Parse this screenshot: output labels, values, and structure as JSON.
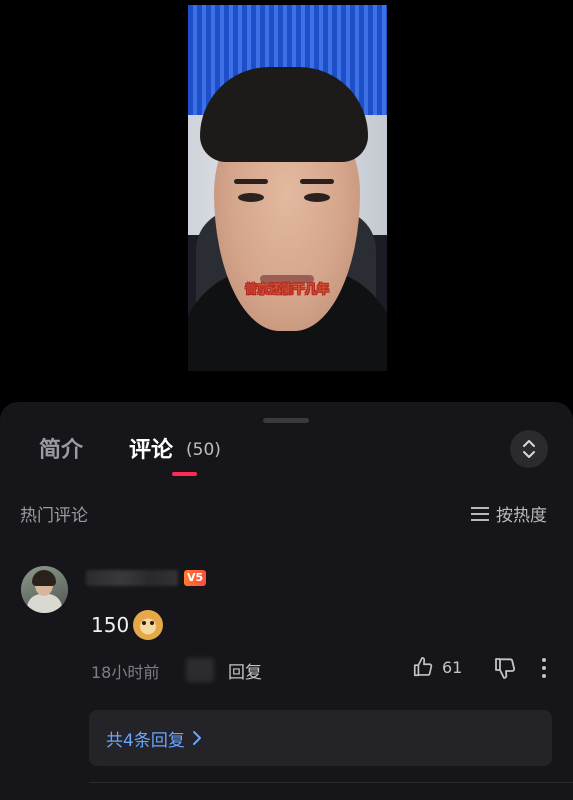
{
  "video": {
    "subtitle": "普京还能干几年"
  },
  "sheet": {
    "tabs": [
      {
        "label": "简介"
      },
      {
        "label": "评论"
      }
    ],
    "comment_count": "(50)",
    "section_title": "热门评论",
    "sort_label": "按热度",
    "icons": {
      "expand": "chevron-up-down-icon",
      "sort": "menu-lines-icon",
      "like": "thumbs-up-icon",
      "dislike": "thumbs-down-icon",
      "more": "more-vertical-icon",
      "replies": "chevron-right-icon"
    }
  },
  "comment": {
    "level_badge": "V5",
    "text": "150",
    "emoji": "doge-emoji",
    "time": "18小时前",
    "reply_label": "回复",
    "likes": "61",
    "replies_label": "共4条回复"
  },
  "colors": {
    "accent": "#fe2c55",
    "link": "#6aa5ff",
    "sheet_bg": "#16161a"
  }
}
